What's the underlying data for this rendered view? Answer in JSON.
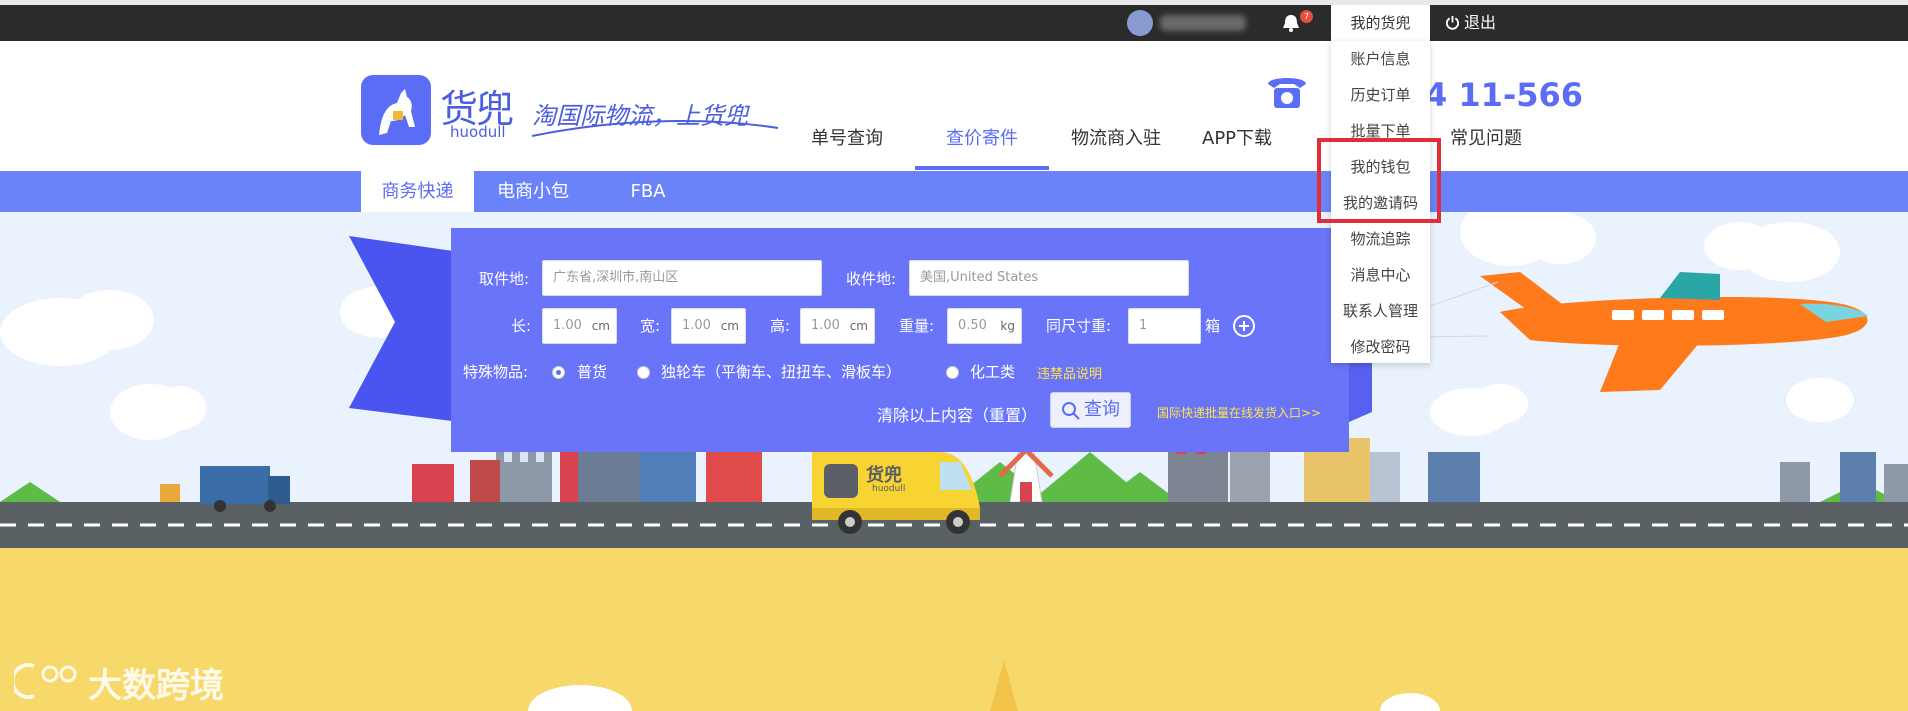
{
  "topbar": {
    "bell_badge": "7",
    "my_account": "我的货兜",
    "logout": "退出"
  },
  "header": {
    "logo_cn": "货兜",
    "logo_en": "huodull",
    "slogan": "淘国际物流，上货兜",
    "phone": "4  11-566",
    "nav": [
      {
        "label": "单号查询"
      },
      {
        "label": "查价寄件"
      },
      {
        "label": "物流商入驻"
      },
      {
        "label": "APP下载"
      },
      {
        "label": "常见问题"
      }
    ]
  },
  "tabs": [
    {
      "label": "商务快递"
    },
    {
      "label": "电商小包"
    },
    {
      "label": "FBA"
    }
  ],
  "form": {
    "pickup_label": "取件地:",
    "pickup_value": "广东省,深圳市,南山区",
    "receive_label": "收件地:",
    "receive_value": "美国,United States",
    "length_label": "长:",
    "length_value": "1.00",
    "width_label": "宽:",
    "width_value": "1.00",
    "height_label": "高:",
    "height_value": "1.00",
    "dim_unit": "cm",
    "weight_label": "重量:",
    "weight_value": "0.50",
    "weight_unit": "kg",
    "same_size_label": "同尺寸重:",
    "same_size_value": "1",
    "box_unit": "箱",
    "special_label": "特殊物品:",
    "opt_general": "普货",
    "opt_unicycle": "独轮车（平衡车、扭扭车、滑板车）",
    "opt_chemical": "化工类",
    "forbidden_link": "违禁品说明",
    "clear_link": "清除以上内容（重置）",
    "query_button": "查询",
    "batch_link": "国际快递批量在线发货入口>>"
  },
  "dropdown": {
    "items": [
      {
        "label": "账户信息"
      },
      {
        "label": "历史订单"
      },
      {
        "label": "批量下单"
      },
      {
        "label": "我的钱包"
      },
      {
        "label": "我的邀请码"
      },
      {
        "label": "物流追踪"
      },
      {
        "label": "消息中心"
      },
      {
        "label": "联系人管理"
      },
      {
        "label": "修改密码"
      }
    ]
  },
  "truck_logo_cn": "货兜",
  "truck_logo_en": "huodull",
  "watermark": "大数跨境",
  "colors": {
    "brand_blue": "#5b6df5",
    "tab_bar": "#6a83f8",
    "highlight_red": "#e02d3a",
    "link_yellow": "#ffe64a"
  }
}
